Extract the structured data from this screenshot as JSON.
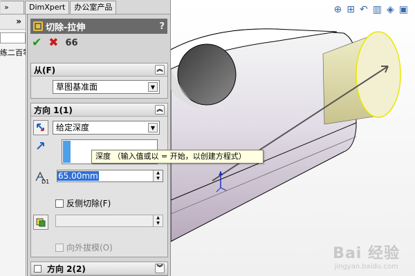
{
  "tabs": [
    "»",
    "DimXpert",
    "办公室产品"
  ],
  "tree": {
    "collapse_glyph": "»",
    "item_fragment": "练二百零"
  },
  "pm": {
    "title": "切除-拉伸",
    "help": "?",
    "from": {
      "label": "从(F)",
      "selected": "草图基准面"
    },
    "direction1": {
      "label": "方向 1(1)",
      "end_condition": "给定深度",
      "depth": "65.00mm",
      "d1_label": "D1",
      "flip_side_label": "反侧切除(F)",
      "flip_side_checked": false,
      "draft_outward_label": "向外拔模(O)",
      "draft_outward_checked": false
    },
    "direction2": {
      "label": "方向 2(2)",
      "checked": false
    }
  },
  "tooltip": "深度 （输入值或以 = 开始，以创建方程式）",
  "watermark": {
    "main": "Bai 经验",
    "sub": "jingyan.baidu.com"
  },
  "colors": {
    "accent_green": "#1a9a1a",
    "cancel_red": "#cc1a1a",
    "selection_blue": "#4ea0e8",
    "highlight_yellow": "#e8e800",
    "title_bar": "#6a6a6a"
  },
  "icons": [
    "collapse-icon",
    "feature-icon",
    "help-icon",
    "ok-icon",
    "cancel-icon",
    "preview-icon",
    "chevron-up-icon",
    "chevron-down-icon",
    "reverse-direction-icon",
    "direction-arrow-icon",
    "dimension-icon",
    "draft-icon",
    "zoom-fit-icon",
    "zoom-area-icon",
    "previous-view-icon",
    "section-view-icon",
    "view-orientation-icon",
    "display-style-icon"
  ]
}
